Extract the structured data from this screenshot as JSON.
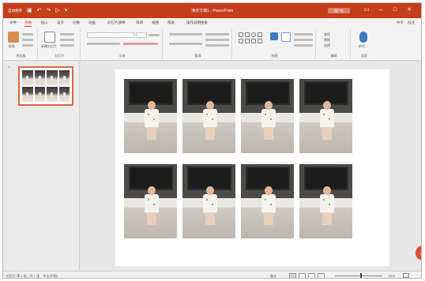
{
  "window": {
    "title": "演示文稿1 - PowerPoint",
    "user": "用户名"
  },
  "quick_access": [
    "自动保存",
    "关",
    "保存",
    "撤消",
    "恢复",
    "从头开始",
    "自定义"
  ],
  "menu_tabs": [
    "文件",
    "开始",
    "插入",
    "设计",
    "切换",
    "动画",
    "幻灯片放映",
    "审阅",
    "视图",
    "帮助",
    "操作说明搜索"
  ],
  "active_tab": "开始",
  "menu_right": [
    "共享",
    "批注"
  ],
  "ribbon": {
    "groups": [
      "剪贴板",
      "幻灯片",
      "字体",
      "段落",
      "绘图",
      "编辑",
      "语音"
    ],
    "paste_label": "粘贴",
    "new_slide_label": "新建幻灯片",
    "find_label": "查找",
    "replace_label": "替换",
    "select_label": "选择",
    "dictate_label": "听写"
  },
  "thumbnail": {
    "number": "1"
  },
  "slide": {
    "photo_count": 8
  },
  "badge": "4",
  "status": {
    "slide_info": "幻灯片 第 1 张，共 1 张",
    "language": "中文(中国)",
    "notes": "备注",
    "zoom": "65%"
  },
  "colors": {
    "accent": "#c43e1c",
    "badge": "#e64a2e",
    "selection": "#e0663e"
  }
}
